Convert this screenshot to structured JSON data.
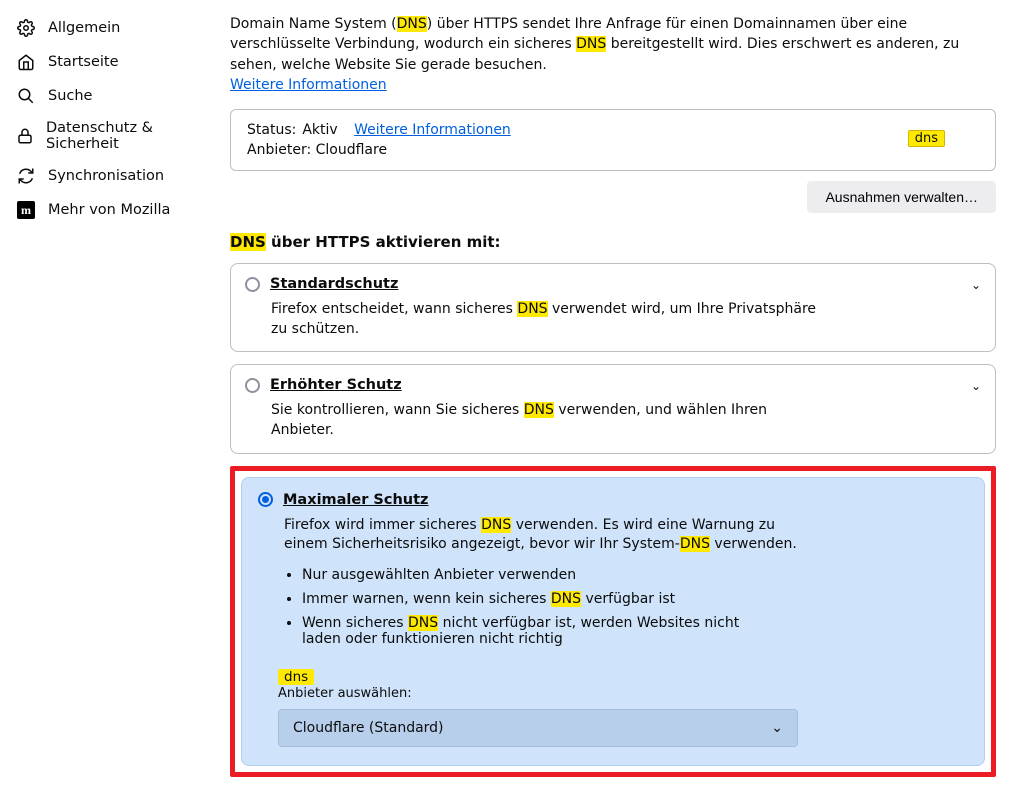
{
  "sidebar": {
    "items": [
      "Allgemein",
      "Startseite",
      "Suche",
      "Datenschutz & Sicherheit",
      "Synchronisation",
      "Mehr von Mozilla"
    ]
  },
  "intro": {
    "p1": "Domain Name System (",
    "hl1": "DNS",
    "p2": ") über HTTPS sendet Ihre Anfrage für einen Domainnamen über eine verschlüsselte Verbindung, wodurch ein sicheres ",
    "hl2": "DNS",
    "p3": " bereitgestellt wird. Dies erschwert es anderen, zu sehen, welche Website Sie gerade besuchen.",
    "more": "Weitere Informationen"
  },
  "status": {
    "label": "Status:",
    "value": "Aktiv",
    "more": "Weitere Informationen",
    "provider_label": "Anbieter:",
    "provider_value": "Cloudflare",
    "search_term": "dns"
  },
  "exceptions_btn": "Ausnahmen verwalten…",
  "section": {
    "hl": "DNS",
    "rest": " über HTTPS aktivieren mit:"
  },
  "opt_default": {
    "title": "Standardschutz",
    "desc_a": "Firefox entscheidet, wann sicheres ",
    "desc_hl": "DNS",
    "desc_b": " verwendet wird, um Ihre Privatsphäre zu schützen."
  },
  "opt_enhanced": {
    "title": "Erhöhter Schutz",
    "desc_a": "Sie kontrollieren, wann Sie sicheres ",
    "desc_hl": "DNS",
    "desc_b": " verwenden, und wählen Ihren Anbieter."
  },
  "opt_max": {
    "title": "Maximaler Schutz",
    "desc_a": "Firefox wird immer sicheres ",
    "desc_hl1": "DNS",
    "desc_b": " verwenden. Es wird eine Warnung zu einem Sicherheitsrisiko angezeigt, bevor wir Ihr System-",
    "desc_hl2": "DNS",
    "desc_c": " verwenden.",
    "li1": "Nur ausgewählten Anbieter verwenden",
    "li2a": "Immer warnen, wenn kein sicheres ",
    "li2hl": "DNS",
    "li2b": " verfügbar ist",
    "li3a": "Wenn sicheres ",
    "li3hl": "DNS",
    "li3b": " nicht verfügbar ist, werden Websites nicht laden oder funktionieren nicht richtig",
    "inline_badge": "dns",
    "provider_label": "Anbieter auswählen:",
    "provider_selected": "Cloudflare (Standard)"
  },
  "chevrons": {
    "down": "⌄"
  }
}
